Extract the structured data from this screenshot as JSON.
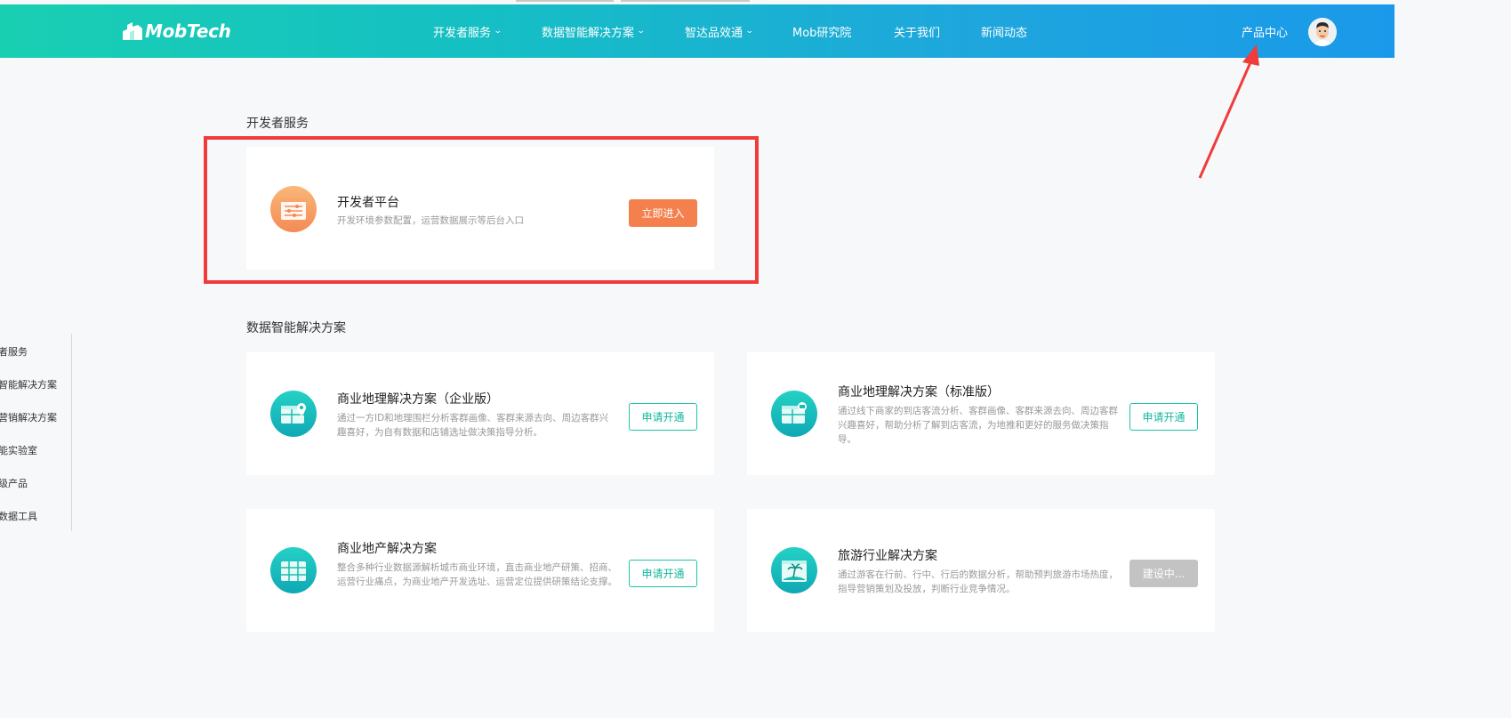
{
  "nav": {
    "logo_text": "MobTech",
    "items": [
      {
        "label": "开发者服务",
        "has_dropdown": true
      },
      {
        "label": "数据智能解决方案",
        "has_dropdown": true
      },
      {
        "label": "智达品效通",
        "has_dropdown": true
      },
      {
        "label": "Mob研究院",
        "has_dropdown": false
      },
      {
        "label": "关于我们",
        "has_dropdown": false
      },
      {
        "label": "新闻动态",
        "has_dropdown": false
      }
    ],
    "product_center": "产品中心",
    "dropdown_icon": "chevron-down-icon",
    "gradient_colors": [
      "#19cfb2",
      "#1a99ea"
    ]
  },
  "sidebar": {
    "items": [
      "者服务",
      "智能解决方案",
      "营销解决方案",
      "能实验室",
      "级产品",
      "数据工具"
    ]
  },
  "sections": [
    {
      "title": "开发者服务",
      "cards": [
        {
          "title": "开发者平台",
          "description": "开发环境参数配置，运营数据展示等后台入口",
          "button": "立即进入",
          "button_style": "primary-orange",
          "icon": "settings-sliders-icon"
        }
      ]
    },
    {
      "title": "数据智能解决方案",
      "cards": [
        {
          "title": "商业地理解决方案（企业版）",
          "description": "通过一方ID和地理围栏分析客群画像、客群来源去向、周边客群兴趣喜好，为自有数据和店铺选址做决策指导分析。",
          "button": "申请开通",
          "button_style": "outline-green",
          "icon": "map-pin-icon"
        },
        {
          "title": "商业地理解决方案（标准版）",
          "description": "通过线下商家的到店客流分析、客群画像、客群来源去向、周边客群兴趣喜好，帮助分析了解到店客流，为地推和更好的服务做决策指导。",
          "button": "申请开通",
          "button_style": "outline-green",
          "icon": "map-store-icon"
        },
        {
          "title": "商业地产解决方案",
          "description": "整合多种行业数据源解析城市商业环境，直击商业地产研策、招商、运营行业痛点，为商业地产开发选址、运营定位提供研策结论支撑。",
          "button": "申请开通",
          "button_style": "outline-green",
          "icon": "grid-building-icon"
        },
        {
          "title": "旅游行业解决方案",
          "description": "通过游客在行前、行中、行后的数据分析，帮助预判旅游市场热度，指导营销策划及投放，判断行业竞争情况。",
          "button": "建设中...",
          "button_style": "disabled-gray",
          "icon": "island-palm-icon"
        }
      ]
    }
  ],
  "annotations": {
    "highlight_color": "#f03b3b"
  }
}
